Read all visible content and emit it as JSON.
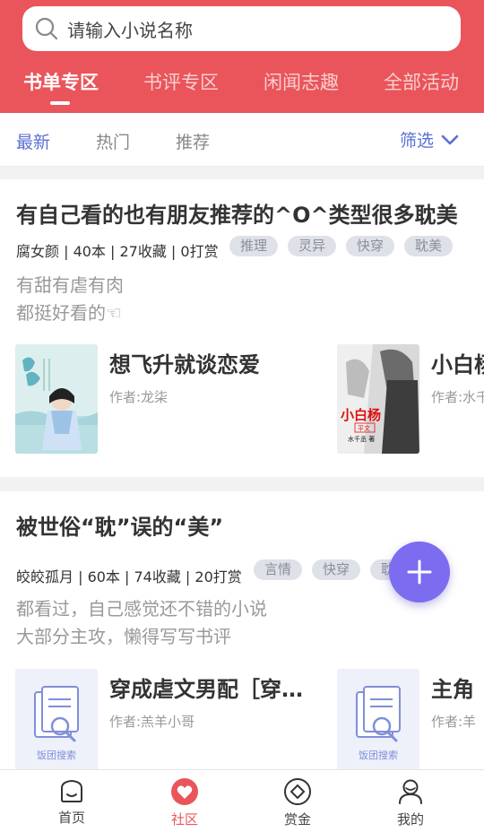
{
  "search": {
    "placeholder": "请输入小说名称"
  },
  "tabs": [
    {
      "label": "书单专区",
      "active": true
    },
    {
      "label": "书评专区"
    },
    {
      "label": "闲闻志趣"
    },
    {
      "label": "全部活动"
    }
  ],
  "filters": {
    "tabs": [
      {
        "label": "最新",
        "active": true
      },
      {
        "label": "热门"
      },
      {
        "label": "推荐"
      }
    ],
    "filter_label": "筛选"
  },
  "posts": [
    {
      "title": "有自己看的也有朋友推荐的^O^类型很多耽美",
      "meta": "腐女颜 | 40本 | 27收藏 | 0打赏",
      "tags": [
        "推理",
        "灵异",
        "快穿",
        "耽美"
      ],
      "desc": [
        "有甜有虐有肉",
        "都挺好看的☜"
      ],
      "books": [
        {
          "name": "想飞升就谈恋爱",
          "author": "作者:龙柒"
        },
        {
          "name": "小白杨",
          "author": "作者:水千丞",
          "cover_text": "小白杨",
          "cover_sub": "平文",
          "cover_author": "水千丞 著"
        }
      ]
    },
    {
      "title": "被世俗“耽”误的“美”",
      "meta": "皎皎孤月 | 60本 | 74收藏 | 20打赏",
      "tags": [
        "言情",
        "快穿",
        "耽美"
      ],
      "desc": [
        "都看过，自己感觉还不错的小说",
        "大部分主攻，懒得写写书评"
      ],
      "books": [
        {
          "name": "穿成虐文男配［穿书］",
          "author": "作者:羔羊小哥",
          "cover_text": "饭团搜索"
        },
        {
          "name": "主角",
          "author": "作者:羊",
          "cover_text": "饭团搜索"
        }
      ]
    }
  ],
  "bottom_nav": [
    {
      "label": "首页",
      "icon": "home-icon"
    },
    {
      "label": "社区",
      "icon": "heart-icon",
      "active": true
    },
    {
      "label": "赏金",
      "icon": "diamond-coin-icon"
    },
    {
      "label": "我的",
      "icon": "user-icon"
    }
  ],
  "colors": {
    "brand": "#e9555a",
    "accent": "#5b6fd6",
    "fab": "#7b6cf0"
  }
}
